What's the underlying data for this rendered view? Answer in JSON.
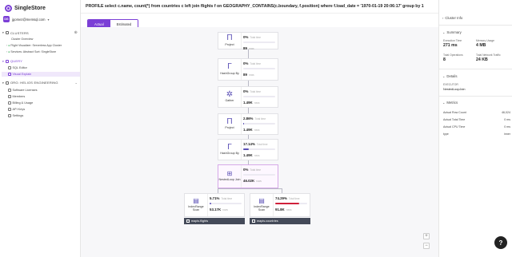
{
  "app": {
    "logo_text": "SingleStore"
  },
  "account": {
    "avatar": "DG",
    "email": "jgomez@memsql.com"
  },
  "sidebar": {
    "clusters_label": "CLUSTERS",
    "cluster_items": [
      {
        "label": "Cluster Overview"
      },
      {
        "label": "Flight Visualizer: Serverless App Cluster"
      },
      {
        "label": "Services: Abstract Sort: SingleStore"
      }
    ],
    "query_label": "QUERY",
    "query_items": [
      {
        "label": "SQL Editor"
      },
      {
        "label": "Visual Explain"
      }
    ],
    "org_label": "ORG: HELIOS ENGINEERING",
    "org_items": [
      {
        "label": "Software Licenses"
      },
      {
        "label": "Members"
      },
      {
        "label": "Billing & Usage"
      },
      {
        "label": "API Keys"
      },
      {
        "label": "Settings"
      }
    ]
  },
  "main": {
    "query": "PROFILE select c.name, count(*) from countries c left join flights f on GEOGRAPHY_CONTAINS(c.boundary, f.position) where f.load_date = '1970-01-19 20:06:17' group by 1",
    "tabs": [
      {
        "label": "Actual"
      },
      {
        "label": "Estimated"
      }
    ],
    "unit_time": "Total time",
    "unit_rows": "rows",
    "nodes": [
      {
        "label": "Project",
        "time": "0%",
        "rows": "89",
        "time_pct": 0
      },
      {
        "label": "HashGroup By",
        "time": "0%",
        "rows": "89",
        "time_pct": 0
      },
      {
        "label": "Gather",
        "time": "0%",
        "rows": "1.49K",
        "time_pct": 0
      },
      {
        "label": "Project",
        "time": "2.86%",
        "rows": "1.49K",
        "time_pct": 2.86
      },
      {
        "label": "HashGroup By",
        "time": "17.14%",
        "rows": "1.49K",
        "time_pct": 17.14
      },
      {
        "label": "NestedLoop Join",
        "time": "0%",
        "rows": "46.02K",
        "time_pct": 0
      },
      {
        "label": "IndexRange Scan",
        "time": "5.71%",
        "rows": "53.17K",
        "time_pct": 5.71,
        "table": "mapis.flights"
      },
      {
        "label": "IndexRange Scan",
        "time": "74.29%",
        "rows": "91.8K",
        "time_pct": 74.29,
        "table": "mapis.countries"
      }
    ],
    "zoom_in": "+",
    "zoom_out": "−"
  },
  "right": {
    "cluster_info": "Cluster Info",
    "summary": "Summary",
    "exec_time_label": "Execution Time",
    "exec_time": "271 ms",
    "mem_label": "Memory Usage",
    "mem": "4 MB",
    "ops_label": "Total Operations",
    "ops": "8",
    "net_label": "Total Network Traffic",
    "net": "24 KB",
    "details": "Details",
    "executor_label": "EXECUTOR",
    "executor": "NestedLoopJoin",
    "metrics": "Metrics",
    "metric_rows": [
      {
        "name": "Actual Row Count",
        "value": "46,024"
      },
      {
        "name": "Actual Total Time",
        "value": "0 ms"
      },
      {
        "name": "Actual CPU Time",
        "value": "0 ms"
      },
      {
        "name": "type",
        "value": "inner"
      }
    ]
  },
  "help": "?"
}
